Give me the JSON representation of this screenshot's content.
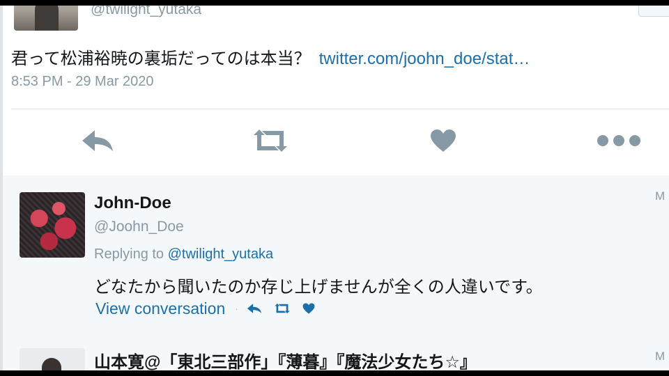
{
  "main_tweet": {
    "handle": "@twilight_yutaka",
    "text": "君って松浦裕暁の裏垢だってのは本当？",
    "link": "twitter.com/joohn_doe/stat…",
    "timestamp": "8:53 PM - 29 Mar 2020",
    "actions": [
      "reply-icon",
      "retweet-icon",
      "like-icon",
      "more-icon"
    ]
  },
  "reply_tweet": {
    "name": "John-Doe",
    "handle": "@Joohn_Doe",
    "replying_prefix": "Replying to",
    "replying_mention": "@twilight_yutaka",
    "text": "どなたから聞いたのか存じ上げませんが全くの人違いです。",
    "view_conversation": "View conversation",
    "separator": "·",
    "time_edge": "M"
  },
  "next_tweet": {
    "name": "山本寛@「東北三部作」『薄暮』『魔法少女たち☆』",
    "time_edge": "M"
  },
  "colors": {
    "link": "#1b6fad",
    "action_icon": "#8899a6",
    "secondary_text": "#8899a6"
  }
}
